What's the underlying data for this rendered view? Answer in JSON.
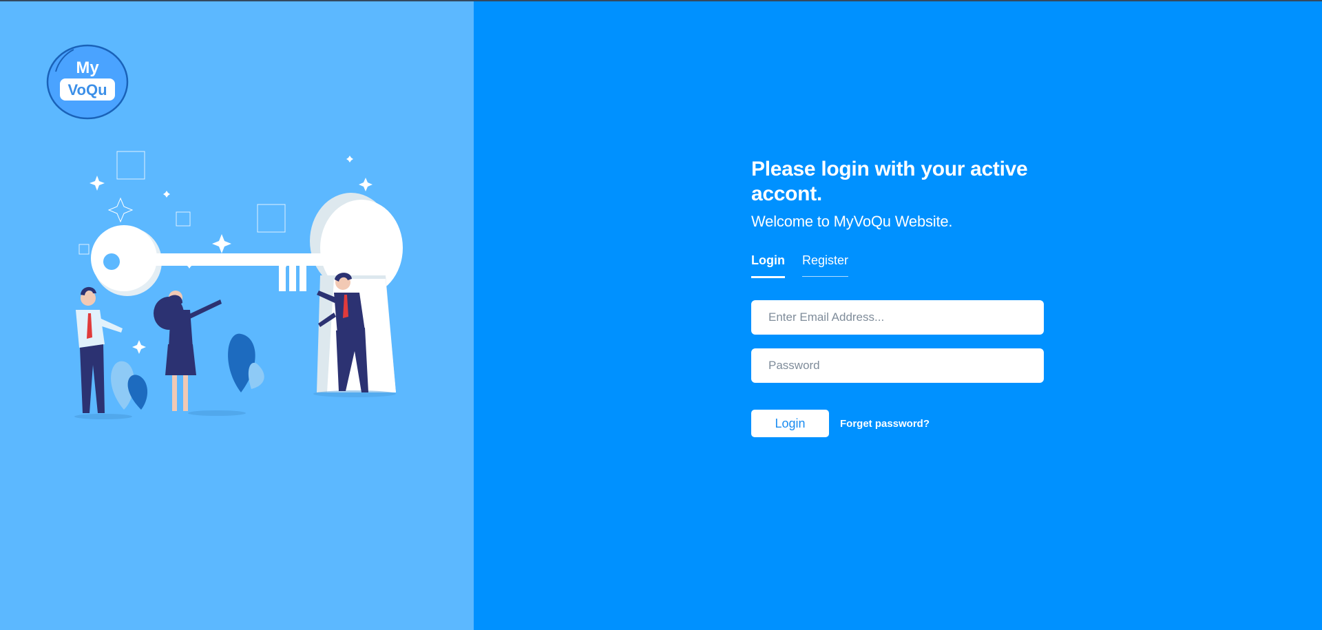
{
  "brand": {
    "logo_top": "My",
    "logo_bottom": "VoQu"
  },
  "colors": {
    "left_panel": "#5cb8ff",
    "right_panel": "#0091ff",
    "accent_text": "#1a8cf0",
    "figure_navy": "#2c3272"
  },
  "login": {
    "heading": "Please login with your active accont.",
    "subheading": "Welcome to MyVoQu Website.",
    "tabs": [
      {
        "label": "Login",
        "active": true
      },
      {
        "label": "Register",
        "active": false
      }
    ],
    "email_placeholder": "Enter Email Address...",
    "email_value": "",
    "password_placeholder": "Password",
    "password_value": "",
    "submit_label": "Login",
    "forgot_label": "Forget password?"
  },
  "icons": {
    "logo": "myvoqu-logo-icon",
    "illustration": "people-carrying-key-illustration"
  }
}
